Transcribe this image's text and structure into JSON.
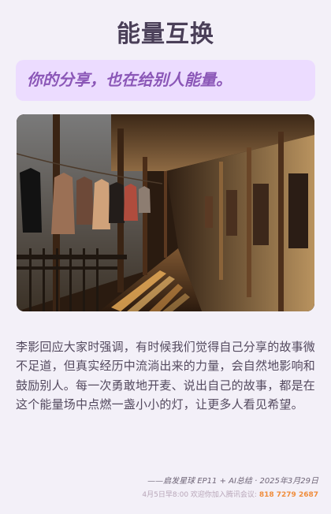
{
  "header": {
    "title": "能量互换"
  },
  "quote": {
    "text": "你的分享，也在给别人能量。"
  },
  "image": {
    "scene": "sunlit corridor with laundry hanging",
    "accent_light": "#f0b15a",
    "accent_dark": "#2b1a0e"
  },
  "body": {
    "paragraph": "李影回应大家时强调，有时候我们觉得自己分享的故事微不足道，但真实经历中流淌出来的力量，会自然地影响和鼓励别人。每一次勇敢地开麦、说出自己的故事，都是在这个能量场中点燃一盏小小的灯，让更多人看见希望。"
  },
  "footer": {
    "source": "——启发星球 EP11 + AI总结 · 2025年3月29日",
    "invite_prefix": "4月5日早8:00 欢迎你加入腾讯会议:",
    "meeting_id": "818 7279 2687"
  },
  "colors": {
    "background": "#f3f0f8",
    "title": "#4a3f58",
    "quote_bg": "#ecdcff",
    "quote_text": "#8b57b7",
    "body_text": "#544a5f",
    "footer_text": "#6f6577",
    "phone": "#f08d3c"
  }
}
